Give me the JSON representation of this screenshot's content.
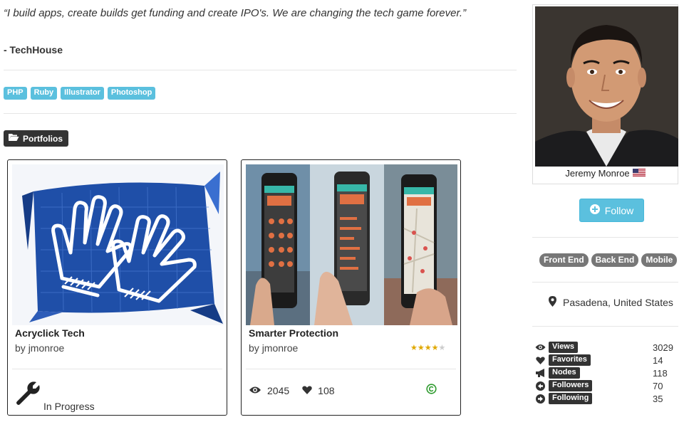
{
  "bio": {
    "quote": "“I build apps, create builds get funding and create IPO's. We are changing the tech game forever.”",
    "author": "- TechHouse"
  },
  "skills": [
    "PHP",
    "Ruby",
    "Illustrator",
    "Photoshop"
  ],
  "portfolios": {
    "label": "Portfolios",
    "cards": [
      {
        "title": "Acryclick Tech",
        "author_prefix": "by",
        "author": "jmonroe",
        "status": "In Progress"
      },
      {
        "title": "Smarter Protection",
        "author_prefix": "by",
        "author": "jmonroe",
        "rating": 4,
        "rating_max": 5,
        "views": "2045",
        "likes": "108"
      }
    ]
  },
  "profile": {
    "name": "Jeremy Monroe",
    "follow_label": "Follow",
    "roles": [
      "Front End",
      "Back End",
      "Mobile"
    ],
    "location": "Pasadena, United States",
    "metrics": [
      {
        "label": "Views",
        "value": "3029",
        "icon": "eye-icon"
      },
      {
        "label": "Favorites",
        "value": "14",
        "icon": "heart-icon"
      },
      {
        "label": "Nodes",
        "value": "118",
        "icon": "megaphone-icon"
      },
      {
        "label": "Followers",
        "value": "70",
        "icon": "arrow-left-circle-icon"
      },
      {
        "label": "Following",
        "value": "35",
        "icon": "arrow-right-circle-icon"
      }
    ]
  },
  "colors": {
    "info": "#5bc0de",
    "dark_label": "#333333",
    "role_tag": "#777777",
    "blueprint": "#1f4fa8",
    "success": "#2e9a2e",
    "star": "#e0a800"
  }
}
